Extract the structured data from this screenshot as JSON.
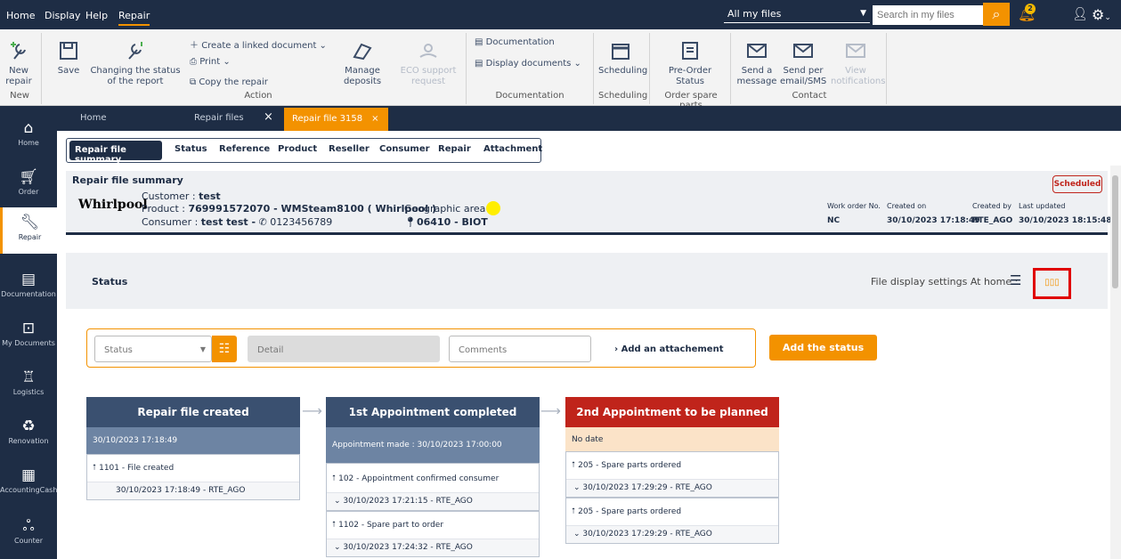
{
  "menu": {
    "home": "Home",
    "display": "Display",
    "help": "Help",
    "repair": "Repair"
  },
  "top": {
    "files_select": "All my files",
    "search_placeholder": "Search in my files",
    "notif_count": "2"
  },
  "ribbon": {
    "new_repair": "New repair",
    "new_group": "New",
    "save": "Save",
    "changing_status": "Changing the status of the report",
    "create_linked": "Create a linked document",
    "print": "Print",
    "copy_repair": "Copy the repair",
    "manage_deposits": "Manage deposits",
    "eco_support": "ECO support request",
    "action_group": "Action",
    "documentation": "Documentation",
    "display_documents": "Display documents",
    "documentation_group": "Documentation",
    "scheduling": "Scheduling",
    "scheduling_group": "Scheduling",
    "preorder_status": "Pre-Order Status",
    "order_spare_group": "Order spare parts",
    "send_message": "Send a message",
    "send_email_sms": "Send per email/SMS",
    "view_notifications": "View notifications",
    "contact_group": "Contact"
  },
  "sidebar": [
    "Home",
    "Order",
    "Repair",
    "Documentation",
    "My Documents",
    "Logistics",
    "Renovation",
    "AccountingCash",
    "Counter"
  ],
  "tabs": {
    "home": "Home",
    "repair_files": "Repair files",
    "active": "Repair file 3158"
  },
  "subnav": [
    "Repair file summary",
    "Status",
    "Reference",
    "Product",
    "Reseller",
    "Consumer",
    "Repair",
    "Attachment"
  ],
  "summary": {
    "title": "Repair file summary",
    "brand": "Whirlpool",
    "customer_label": "Customer : ",
    "customer": "test",
    "product_label": "Product : ",
    "product": "769991572070  -  WMSteam8100 ( Whirlpool )",
    "consumer_label": "Consumer : ",
    "consumer": "test test -",
    "phone": "0123456789",
    "geo_label": "Geographic area :",
    "location": "06410  -  BIOT",
    "badge": "Scheduled",
    "work_order_label": "Work order No.",
    "work_order": "NC",
    "created_on_label": "Created on",
    "created_on": "30/10/2023 17:18:49",
    "created_by_label": "Created by",
    "created_by": "RTE_AGO",
    "last_updated_label": "Last updated",
    "last_updated": "30/10/2023 18:15:48"
  },
  "status_section": {
    "title": "Status",
    "display_settings": "File display settings At home :"
  },
  "form": {
    "status_placeholder": "Status",
    "detail_placeholder": "Detail",
    "comments_placeholder": "Comments",
    "add_attachment": "Add an attachement",
    "add_status": "Add the status"
  },
  "cards": [
    {
      "title": "Repair file created",
      "sub": "30/10/2023 17:18:49",
      "color": "#3a5070",
      "subcolor": "#6d84a3",
      "entries": [
        {
          "t": "1101 - File created",
          "d": "30/10/2023 17:18:49  -  RTE_AGO"
        }
      ]
    },
    {
      "title": "1st Appointment completed",
      "sub": "Appointment made : 30/10/2023 17:00:00",
      "color": "#3a5070",
      "subcolor": "#6d84a3",
      "entries": [
        {
          "t": "102 - Appointment confirmed consumer",
          "d": "30/10/2023 17:21:15  -  RTE_AGO"
        },
        {
          "t": "1102 - Spare part to order",
          "d": "30/10/2023 17:24:32  -  RTE_AGO"
        }
      ]
    },
    {
      "title": "2nd Appointment to be planned",
      "sub": "No date",
      "color": "#c0241b",
      "subcolor": "#fbe3c8",
      "entries": [
        {
          "t": "205 - Spare parts ordered",
          "d": "30/10/2023 17:29:29  -  RTE_AGO"
        },
        {
          "t": "205 - Spare parts ordered",
          "d": "30/10/2023 17:29:29  -  RTE_AGO"
        }
      ]
    }
  ]
}
